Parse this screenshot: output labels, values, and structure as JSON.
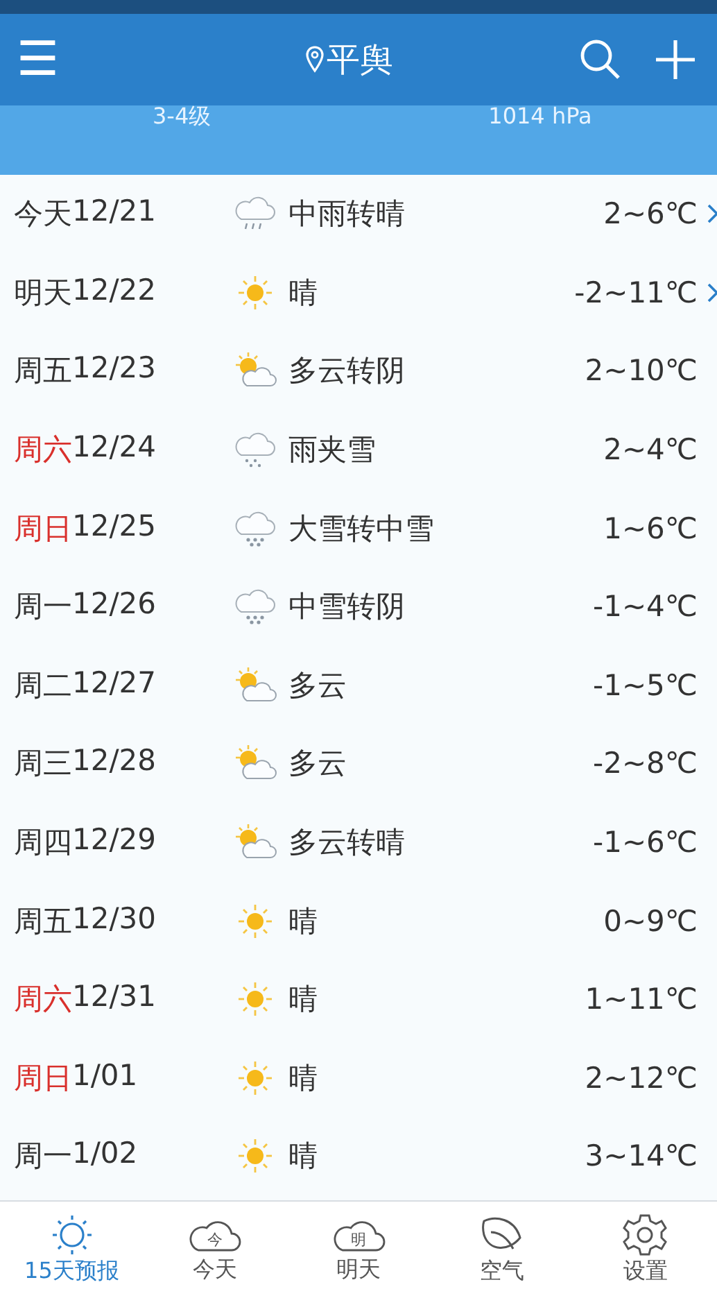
{
  "header": {
    "menu_icon": "☰",
    "city": "平舆"
  },
  "summary": {
    "wind": "3-4级",
    "pressure": "1014 hPa"
  },
  "days": [
    {
      "day": "今天",
      "date": "12/21",
      "weekend": false,
      "kind": "rain",
      "condition": "中雨转晴",
      "temp": "2~6℃",
      "has_detail": true
    },
    {
      "day": "明天",
      "date": "12/22",
      "weekend": false,
      "kind": "sun",
      "condition": "晴",
      "temp": "-2~11℃",
      "has_detail": true
    },
    {
      "day": "周五",
      "date": "12/23",
      "weekend": false,
      "kind": "partly",
      "condition": "多云转阴",
      "temp": "2~10℃",
      "has_detail": false
    },
    {
      "day": "周六",
      "date": "12/24",
      "weekend": true,
      "kind": "sleet",
      "condition": "雨夹雪",
      "temp": "2~4℃",
      "has_detail": false
    },
    {
      "day": "周日",
      "date": "12/25",
      "weekend": true,
      "kind": "snow",
      "condition": "大雪转中雪",
      "temp": "1~6℃",
      "has_detail": false
    },
    {
      "day": "周一",
      "date": "12/26",
      "weekend": false,
      "kind": "snow",
      "condition": "中雪转阴",
      "temp": "-1~4℃",
      "has_detail": false
    },
    {
      "day": "周二",
      "date": "12/27",
      "weekend": false,
      "kind": "partly",
      "condition": "多云",
      "temp": "-1~5℃",
      "has_detail": false
    },
    {
      "day": "周三",
      "date": "12/28",
      "weekend": false,
      "kind": "partly",
      "condition": "多云",
      "temp": "-2~8℃",
      "has_detail": false
    },
    {
      "day": "周四",
      "date": "12/29",
      "weekend": false,
      "kind": "partly",
      "condition": "多云转晴",
      "temp": "-1~6℃",
      "has_detail": false
    },
    {
      "day": "周五",
      "date": "12/30",
      "weekend": false,
      "kind": "sun",
      "condition": "晴",
      "temp": "0~9℃",
      "has_detail": false
    },
    {
      "day": "周六",
      "date": "12/31",
      "weekend": true,
      "kind": "sun",
      "condition": "晴",
      "temp": "1~11℃",
      "has_detail": false
    },
    {
      "day": "周日",
      "date": "1/01",
      "weekend": true,
      "kind": "sun",
      "condition": "晴",
      "temp": "2~12℃",
      "has_detail": false
    },
    {
      "day": "周一",
      "date": "1/02",
      "weekend": false,
      "kind": "sun",
      "condition": "晴",
      "temp": "3~14℃",
      "has_detail": false
    }
  ],
  "nav": [
    {
      "kind": "sun",
      "label": "15天预报",
      "selected": true
    },
    {
      "kind": "cloud",
      "icon_text": "今",
      "label": "今天",
      "selected": false
    },
    {
      "kind": "cloud",
      "icon_text": "明",
      "label": "明天",
      "selected": false
    },
    {
      "kind": "leaf",
      "label": "空气",
      "selected": false
    },
    {
      "kind": "gear",
      "label": "设置",
      "selected": false
    }
  ]
}
